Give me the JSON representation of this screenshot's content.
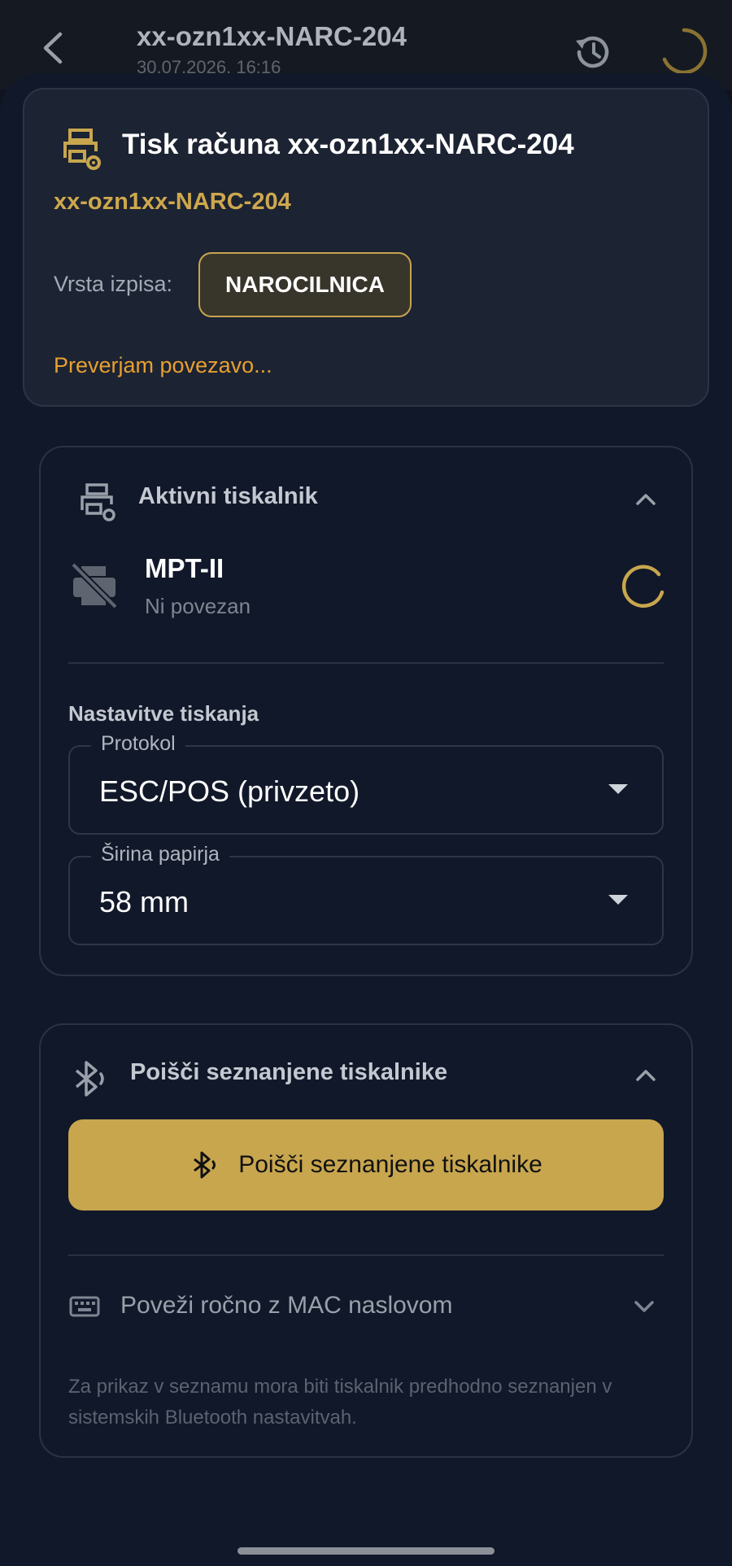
{
  "appbar": {
    "title": "xx-ozn1xx-NARC-204",
    "subtitle": "30.07.2026. 16:16"
  },
  "header": {
    "title": "Tisk računa xx-ozn1xx-NARC-204",
    "code": "xx-ozn1xx-NARC-204",
    "type_label": "Vrsta izpisa:",
    "type_value": "NAROCILNICA",
    "status": "Preverjam povezavo..."
  },
  "active_printer": {
    "section_title": "Aktivni tiskalnik",
    "name": "MPT-II",
    "status": "Ni povezan",
    "settings_title": "Nastavitve tiskanja",
    "protocol_label": "Protokol",
    "protocol_value": "ESC/POS (privzeto)",
    "paper_label": "Širina papirja",
    "paper_value": "58 mm"
  },
  "paired": {
    "section_title": "Poišči seznanjene tiskalnike",
    "button_label": "Poišči seznanjene tiskalnike",
    "manual_label": "Poveži ročno z MAC naslovom",
    "hint": "Za prikaz v seznamu mora biti tiskalnik predhodno seznanjen v sistemskih Bluetooth nastavitvah."
  },
  "colors": {
    "accent": "#c8a64e",
    "warning": "#e8a030",
    "background": "#111829"
  }
}
